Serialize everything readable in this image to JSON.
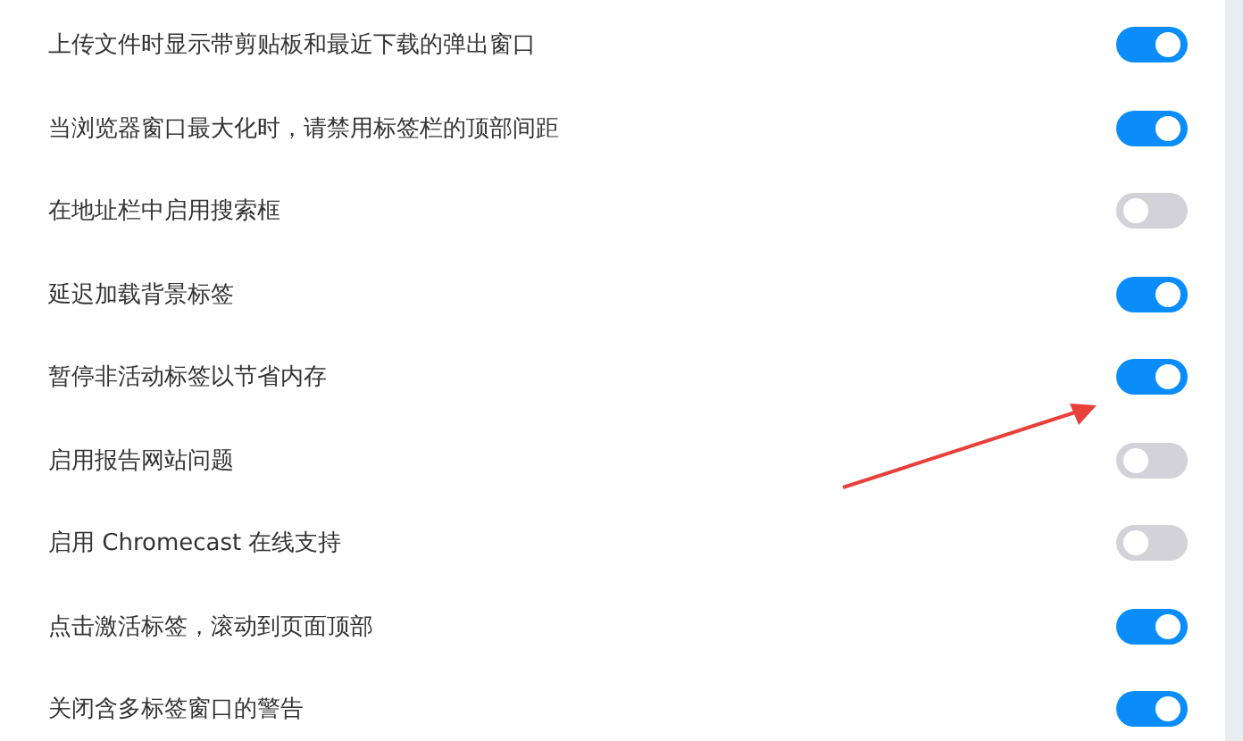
{
  "settings": [
    {
      "label": "上传文件时显示带剪贴板和最近下载的弹出窗口",
      "on": true
    },
    {
      "label": "当浏览器窗口最大化时，请禁用标签栏的顶部间距",
      "on": true
    },
    {
      "label": "在地址栏中启用搜索框",
      "on": false
    },
    {
      "label": "延迟加载背景标签",
      "on": true
    },
    {
      "label": "暂停非活动标签以节省内存",
      "on": true
    },
    {
      "label": "启用报告网站问题",
      "on": false
    },
    {
      "label": "启用 Chromecast 在线支持",
      "on": false
    },
    {
      "label": "点击激活标签，滚动到页面顶部",
      "on": true
    },
    {
      "label": "关闭含多标签窗口的警告",
      "on": true
    }
  ]
}
